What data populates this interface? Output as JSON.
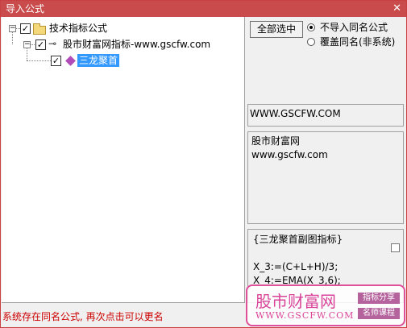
{
  "window": {
    "title": "导入公式",
    "close_glyph": "✕"
  },
  "tree": {
    "root": {
      "label": "技术指标公式",
      "expander": "−",
      "checked": "✓"
    },
    "child": {
      "label": "股市财富网指标-www.gscfw.com",
      "expander": "−",
      "checked": "✓"
    },
    "leaf": {
      "label": "三龙聚首",
      "checked": "✓"
    }
  },
  "options": {
    "select_all_label": "全部选中",
    "radio_skip_label": "不导入同名公式",
    "radio_overwrite_label": "覆盖同名(非系统)",
    "selected": "radio_skip"
  },
  "info": {
    "url": "WWW.GSCFW.COM",
    "desc_line1": "股市财富网",
    "desc_line2": "www.gscfw.com"
  },
  "code": {
    "line1": "{三龙聚首副图指标}",
    "line2": "",
    "line3": "X_3:=(C+L+H)/3;",
    "line4": "X_4:=EMA(X_3,6);"
  },
  "status": {
    "message": "系统存在同名公式, 再次点击可以更名"
  },
  "watermark": {
    "main": "股市财富网",
    "url": "WWW.GSCFW.COM",
    "tag1": "指标分享",
    "tag2": "名师课程"
  },
  "colors": {
    "titlebar": "#c94b4b",
    "selection": "#3399ff",
    "status_text": "#cc0000",
    "watermark": "#e0509a"
  }
}
